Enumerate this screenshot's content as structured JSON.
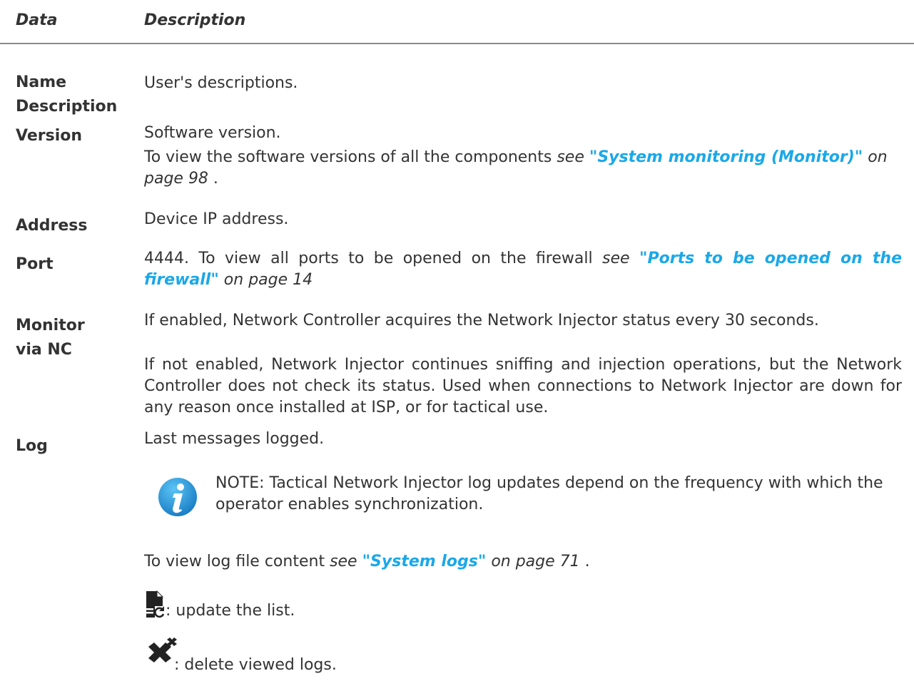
{
  "header": {
    "data": "Data",
    "description": "Description"
  },
  "rows": {
    "name_description": {
      "label_line1": "Name",
      "label_line2": "Description",
      "text": "User's descriptions."
    },
    "version": {
      "label": "Version",
      "text1": "Software version.",
      "text2_pre": "To view the software versions of all the components ",
      "see": "see ",
      "link": "\"System monitoring (Monitor)\"",
      "on_page": " on page 98",
      "tail": " ."
    },
    "address": {
      "label": "Address",
      "text": "Device IP address."
    },
    "port": {
      "label": "Port",
      "text_pre": "4444. To view all ports to be opened on the firewall ",
      "see": "see ",
      "link": "\"Ports to be opened on the firewall\"",
      "on_page": " on page 14"
    },
    "monitor": {
      "label_line1": "Monitor",
      "label_line2": "via NC",
      "text1": "If enabled, Network Controller acquires the Network Injector status every 30 seconds.",
      "text2": "If not enabled, Network Injector continues sniffing and injection operations, but the Network Controller does not check its status. Used when connections to Network Injector are down for any reason once installed at ISP, or for tactical use."
    },
    "log": {
      "label": "Log",
      "text1": "Last messages logged.",
      "note": "NOTE: Tactical Network Injector log updates depend on the frequency with which the operator enables synchronization.",
      "view_pre": "To view log file content ",
      "see": "see ",
      "link": "\"System logs\"",
      "on_page": " on page 71",
      "tail": " .",
      "update_text": ": update the list.",
      "delete_text": ": delete viewed logs."
    }
  },
  "icons": {
    "note": "info-icon",
    "update": "refresh-list-icon",
    "delete": "delete-logs-icon"
  },
  "colors": {
    "link": "#1aa8e8",
    "text": "#333333",
    "rule": "#8a8a8a",
    "info_icon": "#1a8fd0"
  }
}
